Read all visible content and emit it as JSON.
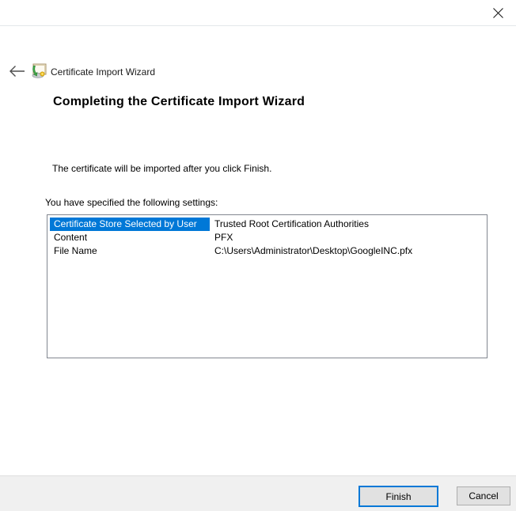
{
  "window": {
    "app_title": "Certificate Import Wizard"
  },
  "header": {
    "back_icon": "back-arrow-icon",
    "app_icon": "certificate-import-wizard-icon",
    "title": "Certificate Import Wizard",
    "close_icon": "close-x-icon"
  },
  "main": {
    "heading": "Completing the Certificate Import Wizard",
    "description": "The certificate will be imported after you click Finish.",
    "settings_label": "You have specified the following settings:",
    "settings": [
      {
        "name": "Certificate Store Selected by User",
        "value": "Trusted Root Certification Authorities",
        "selected": true
      },
      {
        "name": "Content",
        "value": "PFX",
        "selected": false
      },
      {
        "name": "File Name",
        "value": "C:\\Users\\Administrator\\Desktop\\GoogleINC.pfx",
        "selected": false
      }
    ]
  },
  "footer": {
    "finish_label": "Finish",
    "cancel_label": "Cancel"
  },
  "colors": {
    "selection_blue": "#0078d7",
    "focus_border_blue": "#0078d7",
    "footer_background": "#f0f0f0",
    "button_face": "#e1e1e1",
    "button_border": "#adadad",
    "listbox_border": "#828790",
    "titlebar_separator": "#e3e7ea"
  }
}
